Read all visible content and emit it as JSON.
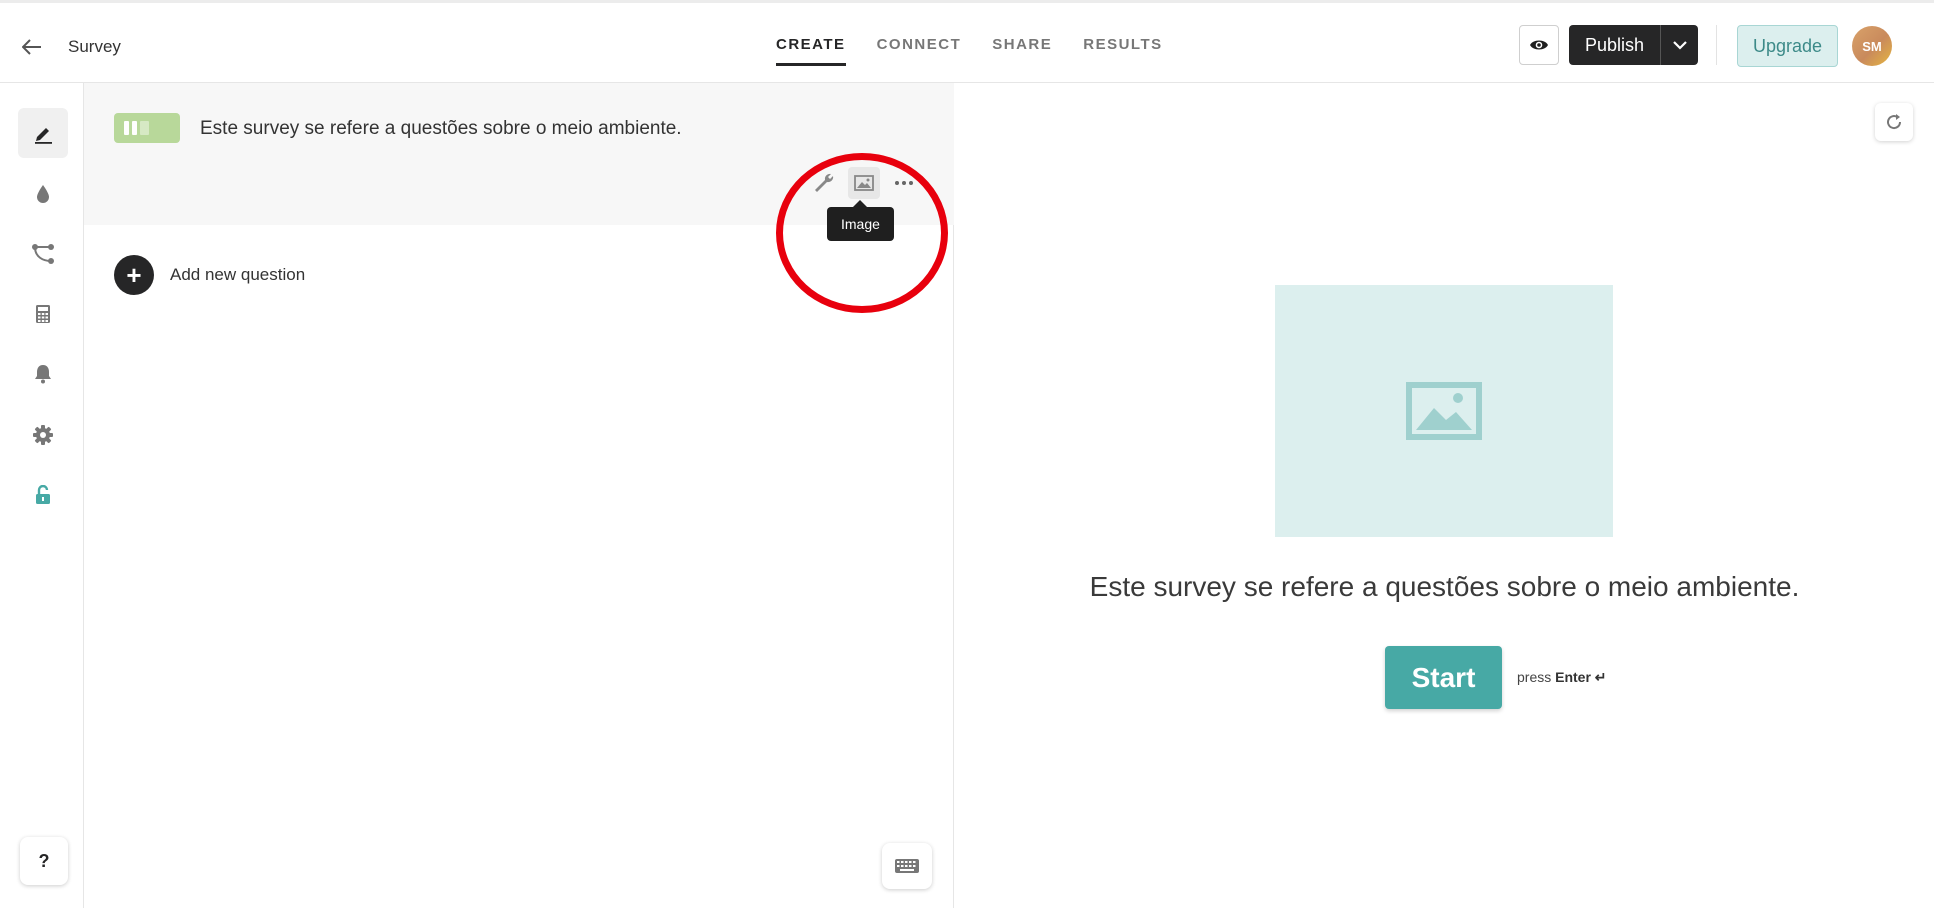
{
  "header": {
    "title": "Survey",
    "tabs": [
      {
        "label": "CREATE",
        "active": true
      },
      {
        "label": "CONNECT",
        "active": false
      },
      {
        "label": "SHARE",
        "active": false
      },
      {
        "label": "RESULTS",
        "active": false
      }
    ],
    "publish_label": "Publish",
    "upgrade_label": "Upgrade",
    "avatar_initials": "SM"
  },
  "sidebar": {
    "items": [
      {
        "icon": "pen-icon",
        "active": true
      },
      {
        "icon": "drop-icon"
      },
      {
        "icon": "logic-icon"
      },
      {
        "icon": "calculator-icon"
      },
      {
        "icon": "bell-icon"
      },
      {
        "icon": "gear-icon"
      },
      {
        "icon": "lock-icon",
        "color": "#47a9a5"
      }
    ],
    "help_label": "?"
  },
  "editor": {
    "welcome_text": "Este survey se refere a questões sobre o meio ambiente.",
    "tooltip": "Image",
    "add_question_label": "Add new question",
    "badge_color": "#b8d89a"
  },
  "preview": {
    "welcome_text": "Este survey se refere a questões sobre o meio ambiente.",
    "start_label": "Start",
    "hint_prefix": "press",
    "hint_key": "Enter ↵",
    "accent_color": "#47a9a5"
  }
}
